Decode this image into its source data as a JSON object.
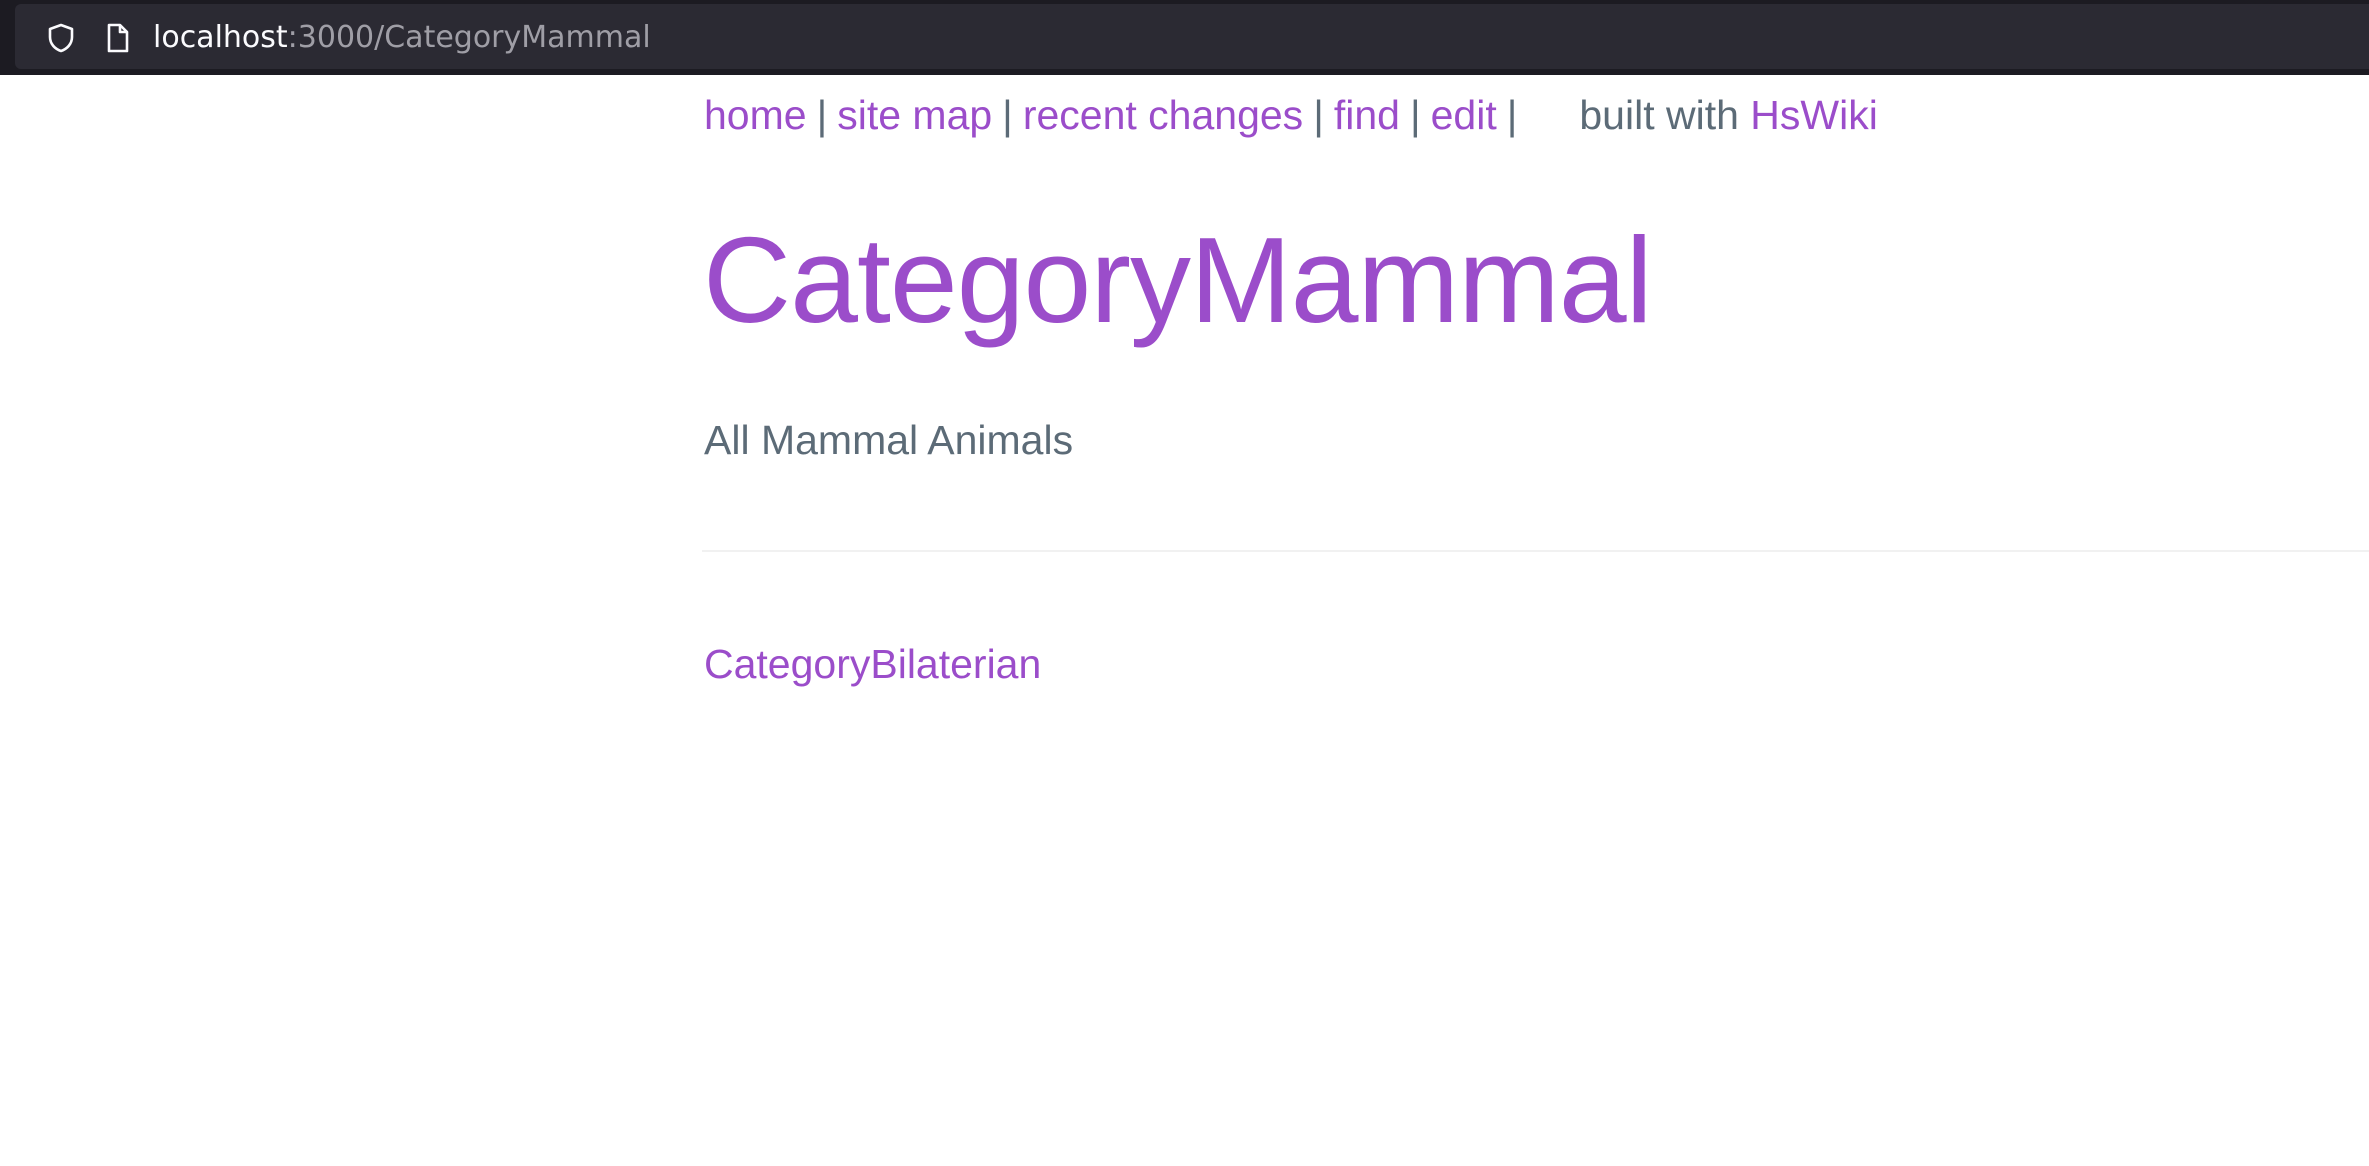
{
  "browser": {
    "url_host": "localhost",
    "url_path": ":3000/CategoryMammal"
  },
  "nav": {
    "links": [
      {
        "label": "home"
      },
      {
        "label": "site map"
      },
      {
        "label": "recent changes"
      },
      {
        "label": "find"
      },
      {
        "label": "edit"
      }
    ],
    "separator": "|",
    "built_with_text": "built with",
    "built_with_link": "HsWiki"
  },
  "page": {
    "title": "CategoryMammal",
    "description": "All Mammal Animals",
    "category_link": "CategoryBilaterian"
  },
  "colors": {
    "link": "#9b4dca",
    "text": "#5c6b77",
    "toolbar": "#2b2a33"
  },
  "icons": {
    "shield": "shield-icon",
    "page": "page-icon"
  }
}
